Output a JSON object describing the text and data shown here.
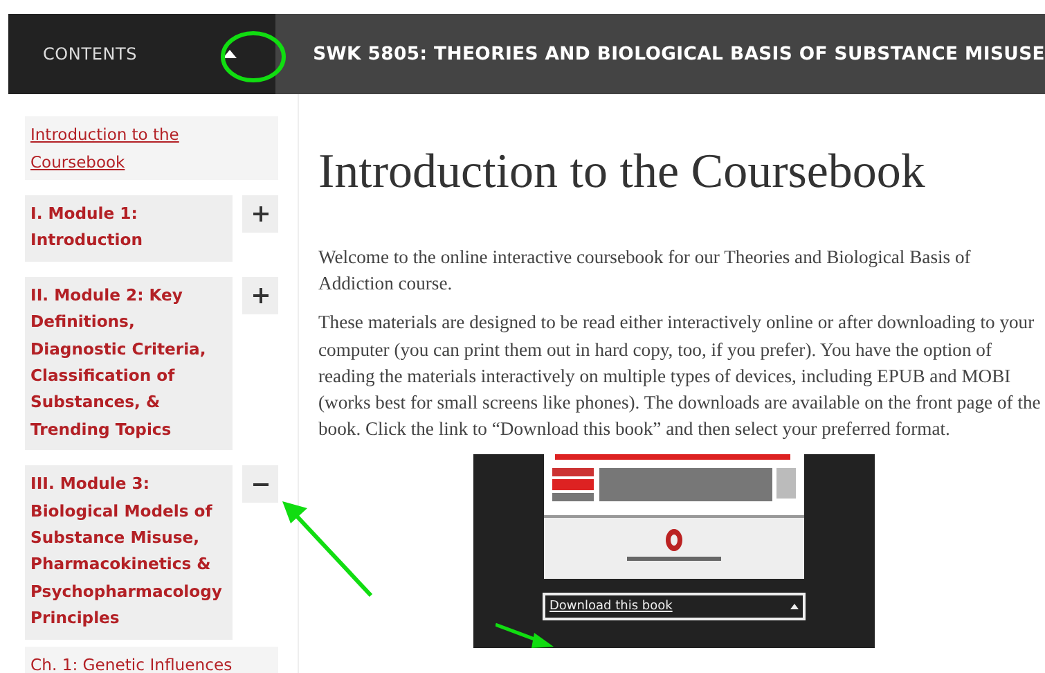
{
  "header": {
    "contents_label": "CONTENTS",
    "book_title": "SWK 5805: THEORIES AND BIOLOGICAL BASIS OF SUBSTANCE MISUSE"
  },
  "toc": {
    "intro": {
      "label": "Introduction to the Coursebook",
      "selected": true
    },
    "modules": [
      {
        "label": "I. Module 1: Introduction",
        "expanded": false
      },
      {
        "label": "II. Module 2: Key Definitions, Diagnostic Criteria, Classification of Substances, & Trending Topics",
        "expanded": false
      },
      {
        "label": "III. Module 3: Biological Models of Substance Misuse, Pharmacokinetics & Psychopharmacology Principles",
        "expanded": true,
        "children": [
          {
            "label": "Ch. 1: Genetic Influences"
          }
        ]
      }
    ]
  },
  "content": {
    "heading": "Introduction to the Coursebook",
    "paragraphs": [
      "Welcome to the online interactive coursebook for our Theories and Biological Basis of Addiction course.",
      "These materials are designed to be read either interactively online or after downloading to your computer (you can print them out in hard copy, too, if you prefer). You have the option of reading the materials interactively on multiple types of devices, including EPUB and MOBI (works best for small screens like phones). The downloads are available on the front page of the book. Click the link to “Download this book” and then select your preferred format."
    ],
    "screenshot": {
      "download_label": "Download this book"
    }
  }
}
